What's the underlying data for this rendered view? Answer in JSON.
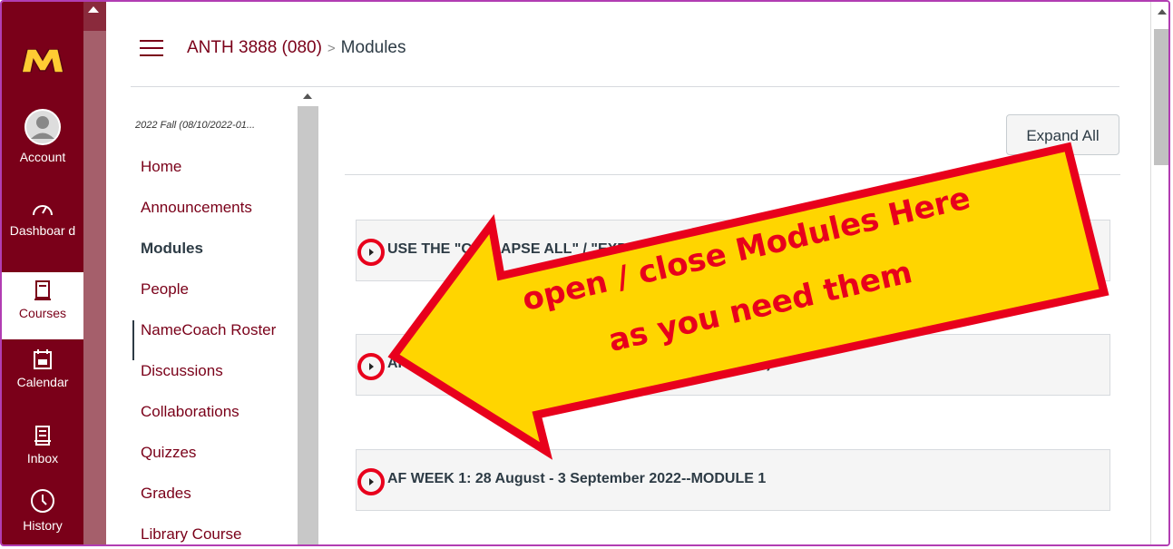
{
  "global_nav": {
    "items": [
      {
        "label": "Account",
        "icon": "user-avatar-icon"
      },
      {
        "label": "Dashboar d",
        "icon": "dashboard-icon"
      },
      {
        "label": "Courses",
        "icon": "courses-icon",
        "active": true
      },
      {
        "label": "Calendar",
        "icon": "calendar-icon"
      },
      {
        "label": "Inbox",
        "icon": "inbox-icon"
      },
      {
        "label": "History",
        "icon": "history-icon"
      }
    ],
    "color": "#7a0019"
  },
  "header": {
    "course": "ANTH 3888 (080)",
    "separator": ">",
    "page": "Modules"
  },
  "course_nav": {
    "term": "2022 Fall (08/10/2022-01...",
    "items": [
      {
        "label": "Home"
      },
      {
        "label": "Announcements"
      },
      {
        "label": "Modules",
        "active": true
      },
      {
        "label": "People"
      },
      {
        "label": "NameCoach Roster"
      },
      {
        "label": "Discussions"
      },
      {
        "label": "Collaborations"
      },
      {
        "label": "Quizzes"
      },
      {
        "label": "Grades"
      },
      {
        "label": "Library Course"
      }
    ]
  },
  "main": {
    "expand_all_label": "Expand All",
    "modules": [
      {
        "title": "USE THE \"COLLAPSE ALL\" / \"EXPAND ALL\" BUTTONS"
      },
      {
        "title": "AF WEEK 0: ORIENTATION (NOTHING IS DUE, but read)"
      },
      {
        "title": "AF WEEK 1: 28 August - 3 September 2022--MODULE 1"
      }
    ]
  },
  "callout": {
    "line1": "open / close Modules Here",
    "line2": "as you need them",
    "fill_color": "#ffd500",
    "stroke_color": "#e8001c"
  }
}
